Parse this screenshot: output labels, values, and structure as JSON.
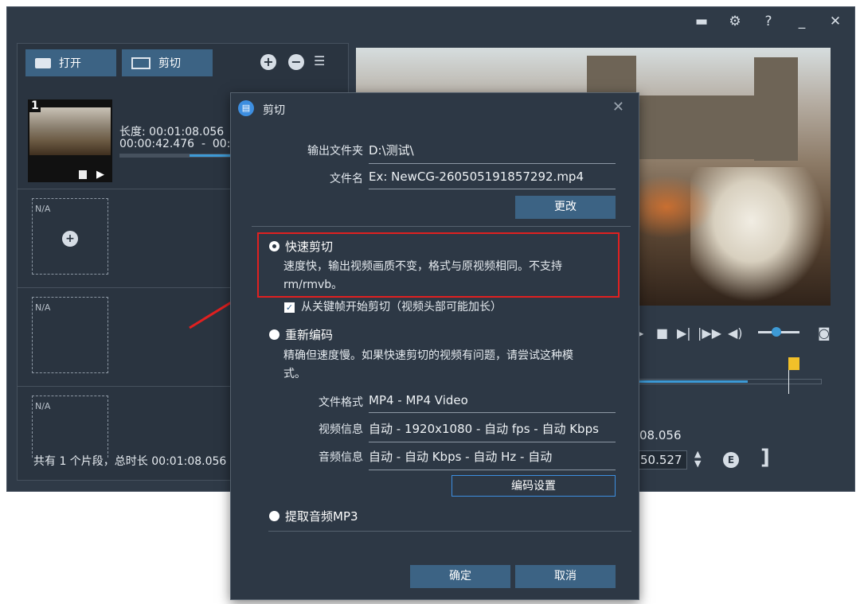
{
  "left": {
    "open_label": "打开",
    "cut_label": "剪切",
    "clip": {
      "index": "1",
      "length_text": "长度: 00:01:08.056",
      "range_text": "00:00:42.476  -  00:"
    },
    "slots": [
      {
        "label": "N/A"
      },
      {
        "label": "N/A"
      },
      {
        "label": "N/A"
      }
    ],
    "status": "共有 1 个片段，总时长 00:01:08.056"
  },
  "right": {
    "time_top": "08.056",
    "time_field": "50.527",
    "bracket": "]"
  },
  "dialog": {
    "title": "剪切",
    "output_folder_label": "输出文件夹",
    "output_folder_value": "D:\\测试\\",
    "filename_label": "文件名",
    "filename_value": "Ex: NewCG-260505191857292.mp4",
    "change_btn": "更改",
    "fast_cut": {
      "title": "快速剪切",
      "desc_line1": "速度快，输出视频画质不变，格式与原视频相同。不支持",
      "desc_line2": "rm/rmvb。",
      "selected": true
    },
    "keyframe_checkbox": "从关键帧开始剪切（视频头部可能加长）",
    "reencode": {
      "title": "重新编码",
      "desc_line1": "精确但速度慢。如果快速剪切的视频有问题，请尝试这种模",
      "desc_line2": "式。",
      "format_label": "文件格式",
      "format_value": "MP4 - MP4 Video",
      "video_label": "视频信息",
      "video_value": "自动 - 1920x1080 - 自动 fps - 自动 Kbps",
      "audio_label": "音频信息",
      "audio_value": "自动 - 自动 Kbps - 自动 Hz - 自动",
      "encode_settings_btn": "编码设置"
    },
    "extract_mp3": "提取音频MP3",
    "ok_btn": "确定",
    "cancel_btn": "取消"
  },
  "colors": {
    "accent": "#3c6384",
    "highlight_box": "#e02020",
    "progress": "#3d9ad6"
  },
  "player": {
    "volume": 0.45,
    "progress": 0.6
  }
}
